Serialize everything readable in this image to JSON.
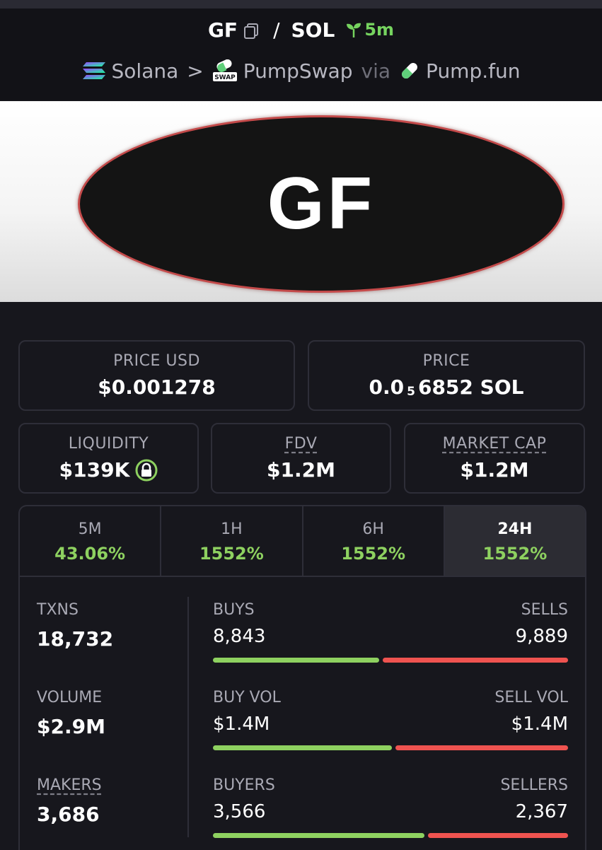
{
  "header": {
    "token": "GF",
    "quote": "SOL",
    "separator": "/",
    "age": "5m",
    "chain": "Solana",
    "dex": "PumpSwap",
    "via_label": "via",
    "launchpad": "Pump.fun",
    "chevron": ">",
    "swap_badge": "SWAP"
  },
  "banner": {
    "logo_text": "GF"
  },
  "prices": {
    "price_usd_label": "PRICE USD",
    "price_usd": "$0.001278",
    "price_label": "PRICE",
    "price_prefix": "0.0",
    "price_subscript": "5",
    "price_suffix": "6852 SOL"
  },
  "metrics": {
    "liquidity_label": "LIQUIDITY",
    "liquidity": "$139K",
    "fdv_label": "FDV",
    "fdv": "$1.2M",
    "mcap_label": "MARKET CAP",
    "mcap": "$1.2M"
  },
  "tabs": [
    {
      "label": "5M",
      "change": "43.06%"
    },
    {
      "label": "1H",
      "change": "1552%"
    },
    {
      "label": "6H",
      "change": "1552%"
    },
    {
      "label": "24H",
      "change": "1552%"
    }
  ],
  "active_tab": "24H",
  "stats": {
    "txns_label": "TXNS",
    "txns": "18,732",
    "volume_label": "VOLUME",
    "volume": "$2.9M",
    "makers_label": "MAKERS",
    "makers": "3,686",
    "buys_label": "BUYS",
    "buys": "8,843",
    "sells_label": "SELLS",
    "sells": "9,889",
    "buy_vol_label": "BUY VOL",
    "buy_vol": "$1.4M",
    "sell_vol_label": "SELL VOL",
    "sell_vol": "$1.4M",
    "buyers_label": "BUYERS",
    "buyers": "3,566",
    "sellers_label": "SELLERS",
    "sellers": "2,367"
  },
  "ratios": {
    "buys_share": 0.472,
    "buy_vol_share": 0.51,
    "buyers_share": 0.601
  },
  "colors": {
    "positive": "#8ed160",
    "negative": "#ef5350",
    "age": "#76d35f",
    "background": "#17171d"
  },
  "icons": [
    "copy-icon",
    "sprout-icon",
    "solana-icon",
    "pumpswap-icon",
    "pill-icon",
    "lock-icon"
  ]
}
